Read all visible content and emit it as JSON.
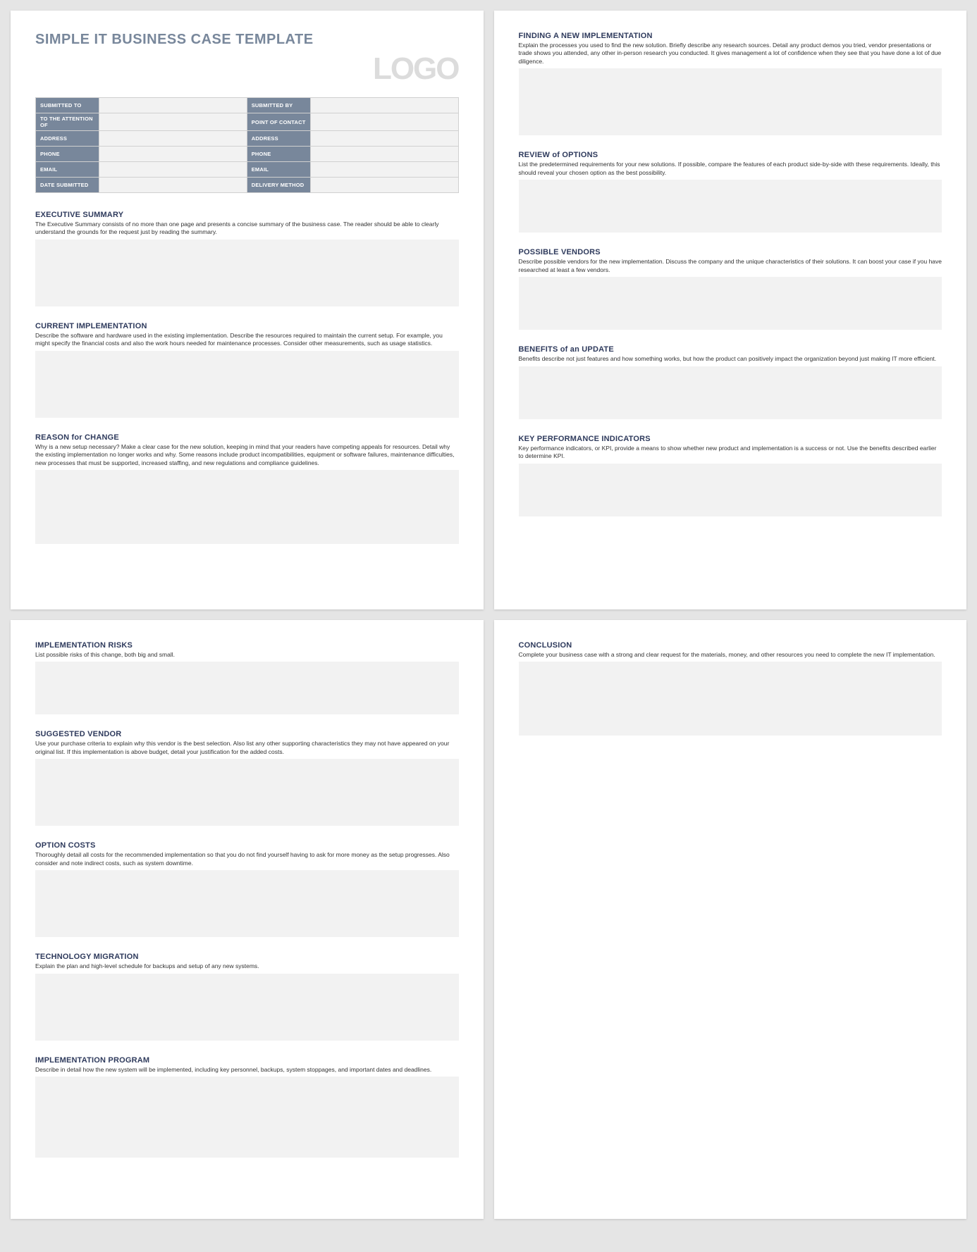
{
  "title": "SIMPLE IT BUSINESS CASE TEMPLATE",
  "logo": "LOGO",
  "headerFields": {
    "submittedTo": "SUBMITTED TO",
    "submittedBy": "SUBMITTED BY",
    "attentionOf": "TO THE ATTENTION OF",
    "pointOfContact": "POINT OF CONTACT",
    "address1": "ADDRESS",
    "address2": "ADDRESS",
    "phone1": "PHONE",
    "phone2": "PHONE",
    "email1": "EMAIL",
    "email2": "EMAIL",
    "dateSubmitted": "DATE SUBMITTED",
    "deliveryMethod": "DELIVERY METHOD"
  },
  "sections": {
    "executiveSummary": {
      "heading": "EXECUTIVE SUMMARY",
      "desc": "The Executive Summary consists of no more than one page and presents a concise summary of the business case. The reader should be able to clearly understand the grounds for the request just by reading the summary."
    },
    "currentImplementation": {
      "heading": "CURRENT IMPLEMENTATION",
      "desc": "Describe the software and hardware used in the existing implementation. Describe the resources required to maintain the current setup. For example, you might specify the financial costs and also the work hours needed for maintenance processes. Consider other measurements, such as usage statistics."
    },
    "reasonForChange": {
      "heading": "REASON for CHANGE",
      "desc": "Why is a new setup necessary? Make a clear case for the new solution, keeping in mind that your readers have competing appeals for resources. Detail why the existing implementation no longer works and why. Some reasons include product incompatibilities, equipment or software failures, maintenance difficulties, new processes that must be supported, increased staffing, and new regulations and compliance guidelines."
    },
    "findingNewImplementation": {
      "heading": "FINDING A NEW IMPLEMENTATION",
      "desc": "Explain the processes you used to find the new solution. Briefly describe any research sources. Detail any product demos you tried, vendor presentations or trade shows you attended, any other in-person research you conducted. It gives management a lot of confidence when they see that you have done a lot of due diligence."
    },
    "reviewOfOptions": {
      "heading": "REVIEW of OPTIONS",
      "desc": "List the predetermined requirements for your new solutions. If possible, compare the features of each product side-by-side with these requirements. Ideally, this should reveal your chosen option as the best possibility."
    },
    "possibleVendors": {
      "heading": "POSSIBLE VENDORS",
      "desc": "Describe possible vendors for the new implementation. Discuss the company and the unique characteristics of their solutions. It can boost your case if you have researched at least a few vendors."
    },
    "benefitsOfUpdate": {
      "heading": "BENEFITS of an UPDATE",
      "desc": "Benefits describe not just features and how something works, but how the product can positively impact the organization beyond just making IT more efficient."
    },
    "kpi": {
      "heading": "KEY PERFORMANCE INDICATORS",
      "desc": "Key performance indicators, or KPI, provide a means to show whether new product and implementation is a success or not. Use the benefits described earlier to determine KPI."
    },
    "implementationRisks": {
      "heading": "IMPLEMENTATION RISKS",
      "desc": "List possible risks of this change, both big and small."
    },
    "suggestedVendor": {
      "heading": "SUGGESTED VENDOR",
      "desc": "Use your purchase criteria to explain why this vendor is the best selection. Also list any other supporting characteristics they may not have appeared on your original list. If this implementation is above budget, detail your justification for the added costs."
    },
    "optionCosts": {
      "heading": "OPTION COSTS",
      "desc": "Thoroughly detail all costs for the recommended implementation so that you do not find yourself having to ask for more money as the setup progresses. Also consider and note indirect costs, such as system downtime."
    },
    "technologyMigration": {
      "heading": "TECHNOLOGY MIGRATION",
      "desc": "Explain the plan and high-level schedule for backups and setup of any new systems."
    },
    "implementationProgram": {
      "heading": "IMPLEMENTATION PROGRAM",
      "desc": "Describe in detail how the new system will be implemented, including key personnel, backups, system stoppages, and important dates and deadlines."
    },
    "conclusion": {
      "heading": "CONCLUSION",
      "desc": "Complete your business case with a strong and clear request for the materials, money, and other resources you need to complete the new IT implementation."
    }
  }
}
